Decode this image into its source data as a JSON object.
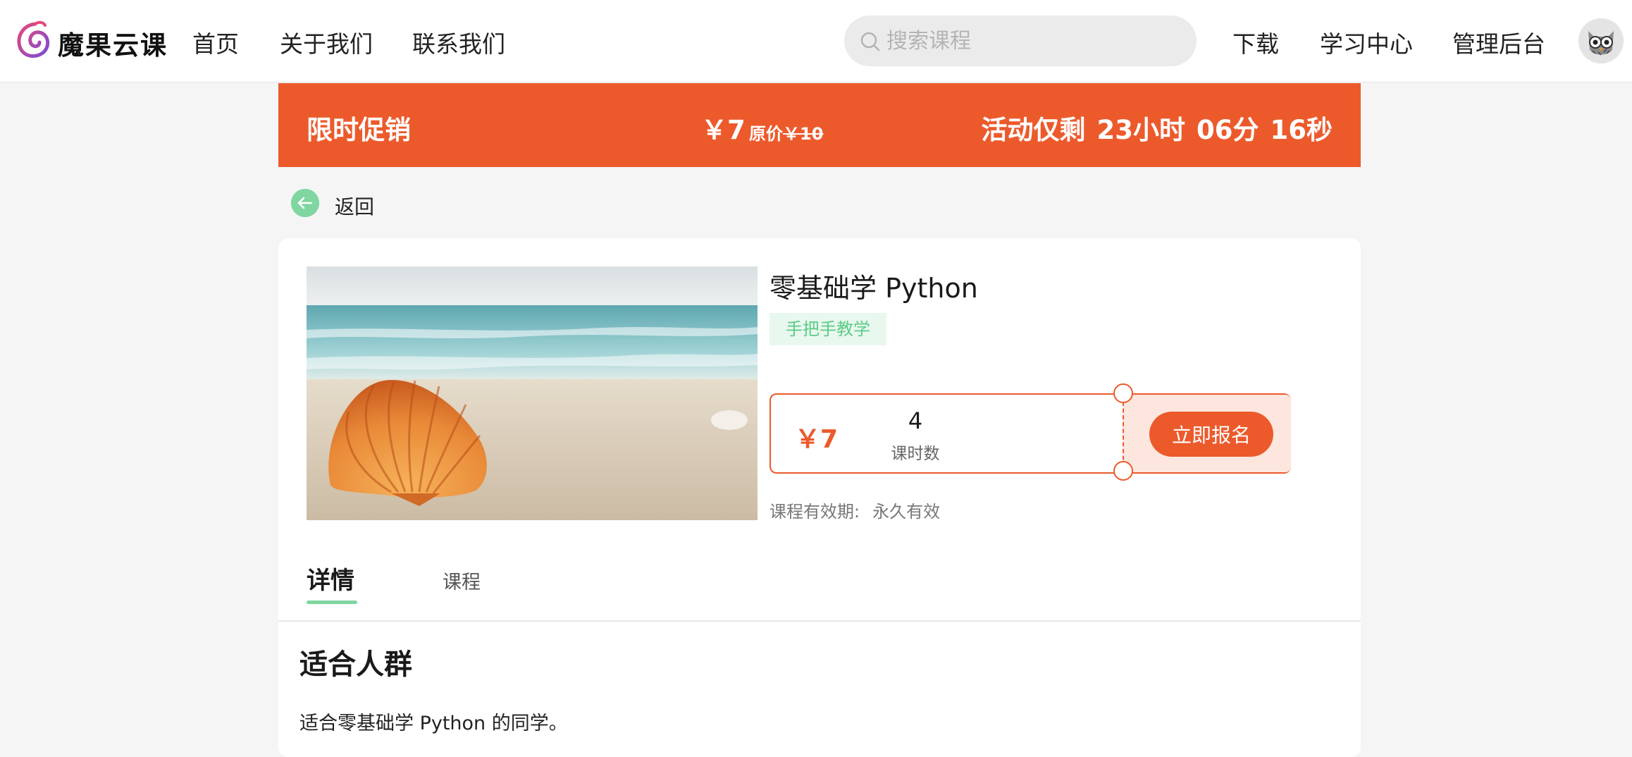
{
  "nav": {
    "brand": "魔果云课",
    "links": [
      "首页",
      "关于我们",
      "联系我们"
    ],
    "search_placeholder": "搜索课程",
    "right_links": [
      "下载",
      "学习中心",
      "管理后台"
    ]
  },
  "promo": {
    "title": "限时促销",
    "price": "￥7",
    "original_label": "原价",
    "original_price": "￥10",
    "countdown_label": "活动仅剩",
    "hours": "23小时",
    "minutes": "06分",
    "seconds": "16秒"
  },
  "back_label": "返回",
  "course": {
    "title": "零基础学 Python",
    "tag": "手把手教学",
    "price": "￥7",
    "lesson_count": "4",
    "lesson_count_label": "课时数",
    "enroll_button": "立即报名",
    "validity_label": "课程有效期:",
    "validity_value": "永久有效"
  },
  "tabs": [
    "详情",
    "课程"
  ],
  "details": {
    "heading": "适合人群",
    "body": "适合零基础学 Python 的同学。"
  },
  "colors": {
    "accent": "#ec5a2c",
    "green": "#7fd6a0",
    "tag_bg": "#e8f8ee"
  },
  "icons": [
    "logo-icon",
    "search-icon",
    "avatar-owl-icon",
    "back-arrow-icon"
  ]
}
